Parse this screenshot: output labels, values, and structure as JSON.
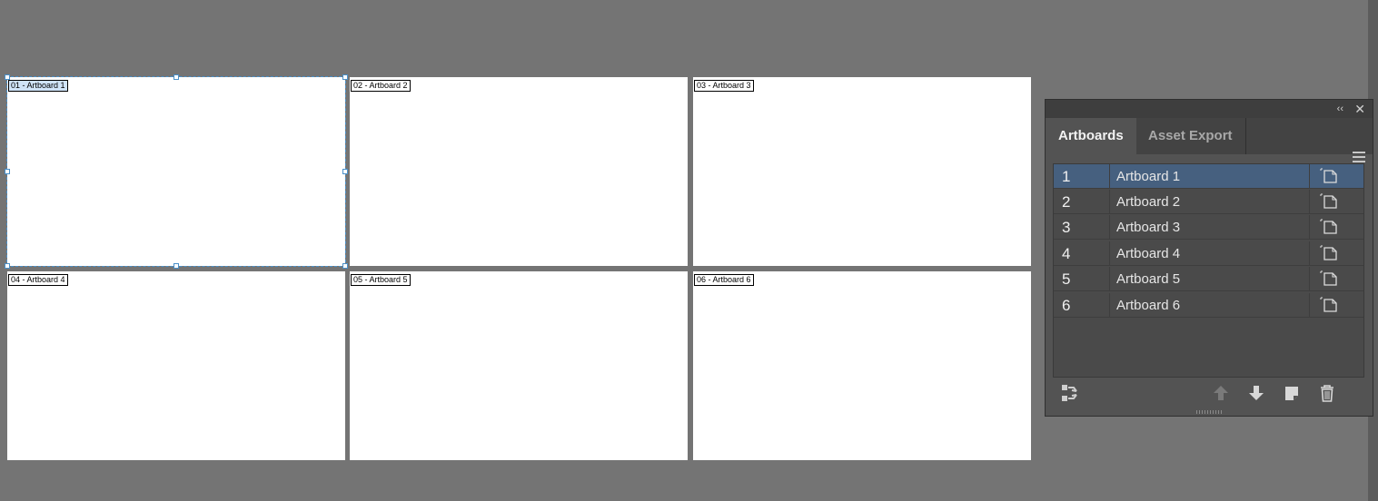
{
  "artboards": [
    {
      "label": "01 - Artboard 1"
    },
    {
      "label": "02 - Artboard 2"
    },
    {
      "label": "03 - Artboard 3"
    },
    {
      "label": "04 - Artboard 4"
    },
    {
      "label": "05 - Artboard 5"
    },
    {
      "label": "06 - Artboard 6"
    }
  ],
  "panel": {
    "collapse_glyph": "‹‹",
    "close_glyph": "✕",
    "tabs": [
      {
        "label": "Artboards"
      },
      {
        "label": "Asset Export"
      }
    ],
    "rows": [
      {
        "num": "1",
        "name": "Artboard 1"
      },
      {
        "num": "2",
        "name": "Artboard 2"
      },
      {
        "num": "3",
        "name": "Artboard 3"
      },
      {
        "num": "4",
        "name": "Artboard 4"
      },
      {
        "num": "5",
        "name": "Artboard 5"
      },
      {
        "num": "6",
        "name": "Artboard 6"
      }
    ],
    "selected_row": 1,
    "icons": {
      "rearrange": "rearrange-icon",
      "move_up": "arrow-up-icon",
      "move_down": "arrow-down-icon",
      "new": "new-artboard-icon",
      "delete": "trash-icon",
      "row_options": "artboard-options-icon",
      "menu": "hamburger-menu-icon"
    }
  },
  "colors": {
    "canvas": "#747474",
    "selection": "#4a90c9",
    "panel_bg": "#535353",
    "selected_row": "#46607f"
  }
}
